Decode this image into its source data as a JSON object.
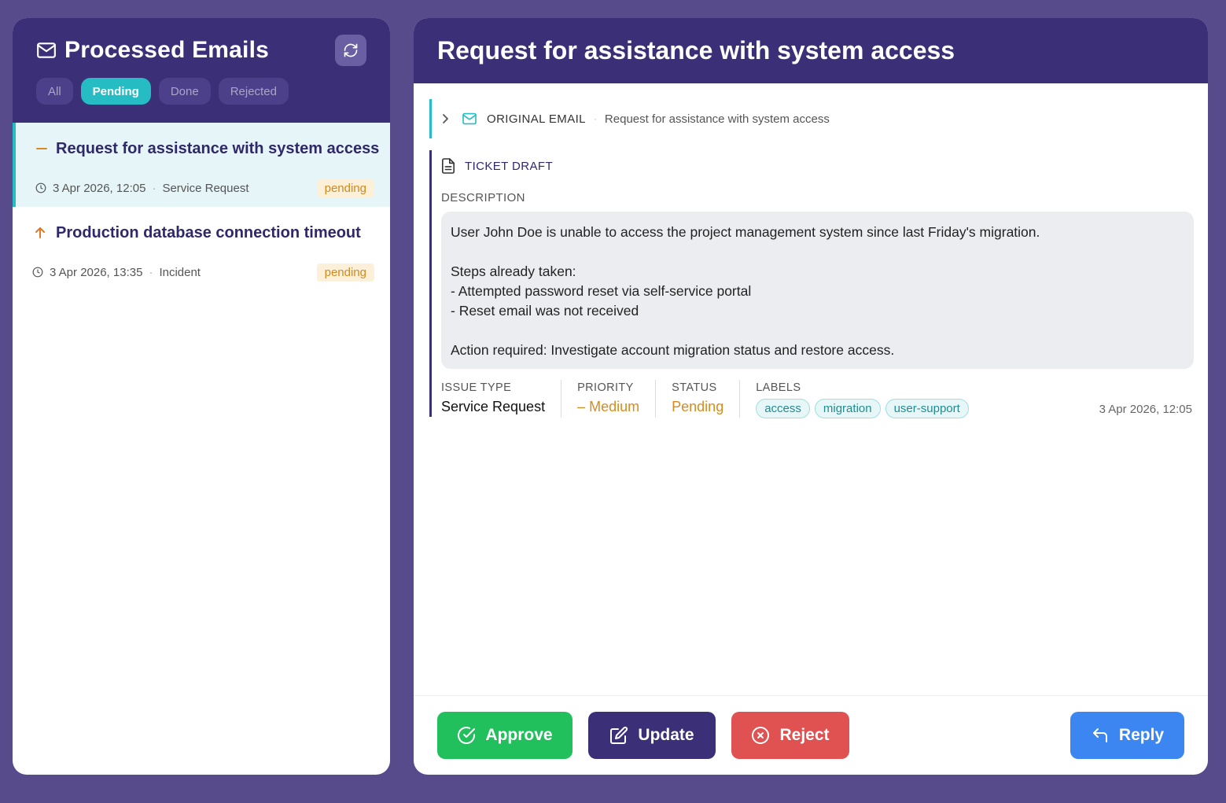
{
  "sidebar": {
    "title": "Processed Emails",
    "filters": [
      "All",
      "Pending",
      "Done",
      "Rejected"
    ],
    "active_filter": "Pending",
    "emails": [
      {
        "subject": "Request for assistance with system access",
        "priority_icon": "minus-icon",
        "date": "3 Apr 2026, 12:05",
        "type": "Service Request",
        "status": "pending"
      },
      {
        "subject": "Production database connection timeout",
        "priority_icon": "arrow-up-icon",
        "date": "3 Apr 2026, 13:35",
        "type": "Incident",
        "status": "pending"
      }
    ]
  },
  "detail": {
    "title": "Request for assistance with system access",
    "original_email": {
      "label": "ORIGINAL EMAIL",
      "subject": "Request for assistance with system access"
    },
    "ticket_draft": {
      "label": "TICKET DRAFT",
      "description_label": "DESCRIPTION",
      "description": "User John Doe is unable to access the project management system since last Friday's migration.\n\nSteps already taken:\n- Attempted password reset via self-service portal\n- Reset email was not received\n\nAction required: Investigate account migration status and restore access.",
      "issue_type_label": "ISSUE TYPE",
      "issue_type": "Service Request",
      "priority_label": "PRIORITY",
      "priority": "Medium",
      "status_label": "STATUS",
      "status": "Pending",
      "labels_label": "LABELS",
      "labels": [
        "access",
        "migration",
        "user-support"
      ],
      "date": "3 Apr 2026, 12:05"
    }
  },
  "actions": {
    "approve": "Approve",
    "update": "Update",
    "reject": "Reject",
    "reply": "Reply"
  },
  "colors": {
    "background": "#584b8c",
    "header": "#3b2f78",
    "accent": "#26bcc4",
    "approve": "#22c05d",
    "reject": "#e05252",
    "reply": "#3b86f0",
    "pending": "#d98a1e"
  }
}
